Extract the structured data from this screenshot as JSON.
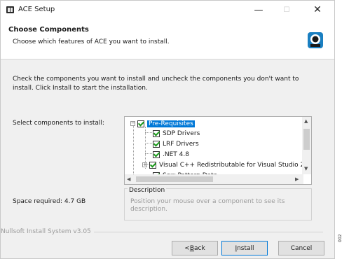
{
  "window": {
    "title": "ACE Setup",
    "controls": {
      "minimize": "—",
      "maximize": "☐",
      "close": "✕"
    }
  },
  "header": {
    "title": "Choose Components",
    "subtitle": "Choose which features of ACE you want to install."
  },
  "intro_text": "Check the components you want to install and uncheck the components you don't want to install. Click Install to start the installation.",
  "components": {
    "label": "Select components to install:",
    "tree": [
      {
        "label": "Pre-Requisites",
        "checked": true,
        "expander": "−",
        "selected": true
      },
      {
        "label": "SDP Drivers",
        "checked": true
      },
      {
        "label": "LRF Drivers",
        "checked": true
      },
      {
        "label": ".NET 4.8",
        "checked": true
      },
      {
        "label": "Visual C++ Redistributable for Visual Studio 2",
        "checked": true,
        "expander": "+"
      },
      {
        "label": "Saw Pattern Data",
        "checked": true
      }
    ]
  },
  "description": {
    "title": "Description",
    "text": "Position your mouse over a component to see its description."
  },
  "space_required": "Space required: 4.7 GB",
  "brand": "Nullsoft Install System v3.05",
  "buttons": {
    "back_prefix": "< ",
    "back_key": "B",
    "back_rest": "ack",
    "install_key": "I",
    "install_rest": "nstall",
    "cancel": "Cancel"
  },
  "side_number": "002",
  "colors": {
    "selection": "#0078d7",
    "checkmark": "#1c9a1c",
    "dialog_bg": "#f0f0f0"
  }
}
